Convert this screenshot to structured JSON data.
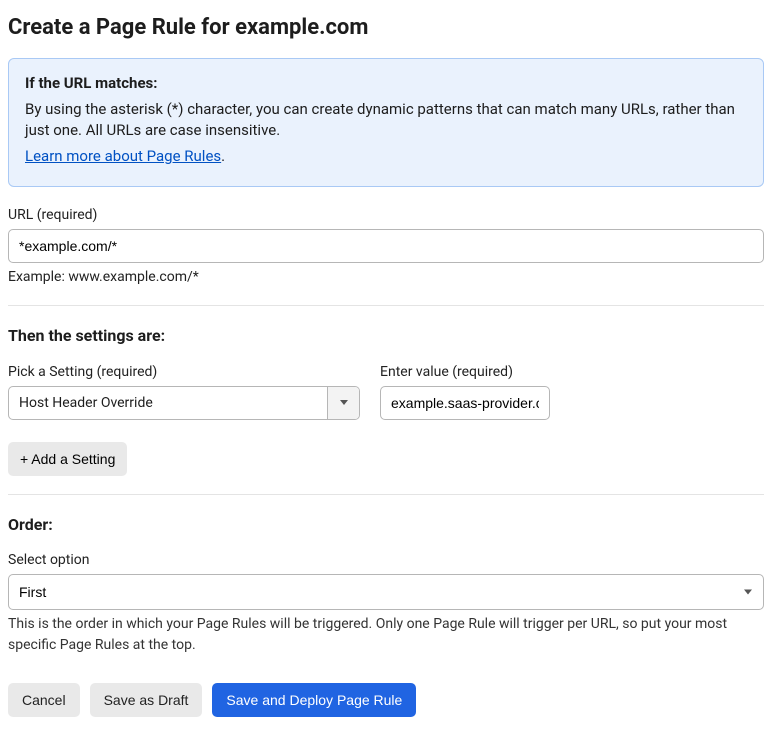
{
  "page": {
    "title": "Create a Page Rule for example.com"
  },
  "info": {
    "heading": "If the URL matches:",
    "body": "By using the asterisk (*) character, you can create dynamic patterns that can match many URLs, rather than just one. All URLs are case insensitive.",
    "link_text": "Learn more about Page Rules",
    "period": "."
  },
  "url_field": {
    "label": "URL (required)",
    "value": "*example.com/*",
    "example": "Example: www.example.com/*"
  },
  "settings": {
    "heading": "Then the settings are:",
    "picker_label": "Pick a Setting (required)",
    "picker_value": "Host Header Override",
    "value_label": "Enter value (required)",
    "value_value": "example.saas-provider.com",
    "add_button": "+ Add a Setting"
  },
  "order": {
    "heading": "Order:",
    "picker_label": "Select option",
    "picker_value": "First",
    "description": "This is the order in which your Page Rules will be triggered. Only one Page Rule will trigger per URL, so put your most specific Page Rules at the top."
  },
  "buttons": {
    "cancel": "Cancel",
    "save_draft": "Save as Draft",
    "save_deploy": "Save and Deploy Page Rule"
  }
}
